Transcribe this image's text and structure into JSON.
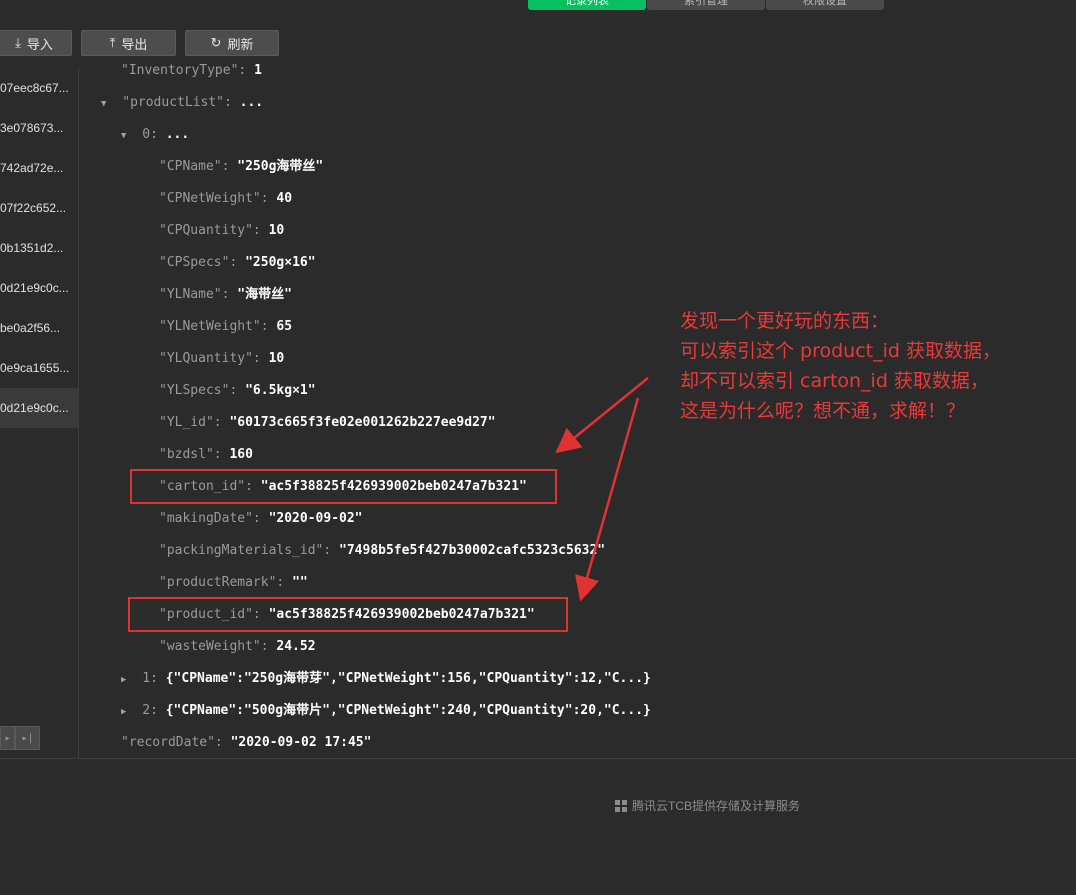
{
  "tabs": [
    {
      "label": "记录列表",
      "active": true
    },
    {
      "label": "索引管理",
      "active": false
    },
    {
      "label": "权限设置",
      "active": false
    }
  ],
  "toolbar": {
    "import_label": "导入",
    "export_label": "导出",
    "refresh_label": "刷新"
  },
  "records": [
    "07eec8c67...",
    "3e078673...",
    "742ad72e...",
    "07f22c652...",
    "0b1351d2...",
    "0d21e9c0c...",
    "be0a2f56...",
    "0e9ca1655...",
    "0d21e9c0c..."
  ],
  "json": {
    "inventoryType": {
      "key": "\"InventoryType\":",
      "value": "1"
    },
    "productList": {
      "key": "\"productList\":",
      "value": "..."
    },
    "item0": {
      "key": "0:",
      "value": "..."
    },
    "fields": [
      {
        "key": "\"CPName\":",
        "value": "\"250g海带丝\""
      },
      {
        "key": "\"CPNetWeight\":",
        "value": "40"
      },
      {
        "key": "\"CPQuantity\":",
        "value": "10"
      },
      {
        "key": "\"CPSpecs\":",
        "value": "\"250g×16\""
      },
      {
        "key": "\"YLName\":",
        "value": "\"海带丝\""
      },
      {
        "key": "\"YLNetWeight\":",
        "value": "65"
      },
      {
        "key": "\"YLQuantity\":",
        "value": "10"
      },
      {
        "key": "\"YLSpecs\":",
        "value": "\"6.5kg×1\""
      },
      {
        "key": "\"YL_id\":",
        "value": "\"60173c665f3fe02e001262b227ee9d27\""
      },
      {
        "key": "\"bzdsl\":",
        "value": "160"
      },
      {
        "key": "\"carton_id\":",
        "value": "\"ac5f38825f426939002beb0247a7b321\""
      },
      {
        "key": "\"makingDate\":",
        "value": "\"2020-09-02\""
      },
      {
        "key": "\"packingMaterials_id\":",
        "value": "\"7498b5fe5f427b30002cafc5323c5632\""
      },
      {
        "key": "\"productRemark\":",
        "value": "\"\""
      },
      {
        "key": "\"product_id\":",
        "value": "\"ac5f38825f426939002beb0247a7b321\""
      },
      {
        "key": "\"wasteWeight\":",
        "value": "24.52"
      }
    ],
    "item1": {
      "key": "1:",
      "value": "{\"CPName\":\"250g海带芽\",\"CPNetWeight\":156,\"CPQuantity\":12,\"C...}"
    },
    "item2": {
      "key": "2:",
      "value": "{\"CPName\":\"500g海带片\",\"CPNetWeight\":240,\"CPQuantity\":20,\"C...}"
    },
    "recordDate": {
      "key": "\"recordDate\":",
      "value": "\"2020-09-02 17:45\""
    }
  },
  "footer": {
    "text": "腾讯云TCB提供存储及计算服务"
  },
  "annotation": {
    "line1": "发现一个更好玩的东西：",
    "line2": "可以索引这个 product_id 获取数据，",
    "line3": "却不可以索引 carton_id 获取数据，",
    "line4": "这是为什么呢？想不通，求解！？"
  },
  "colors": {
    "accent": "#07c160",
    "annotation": "#e03232"
  }
}
